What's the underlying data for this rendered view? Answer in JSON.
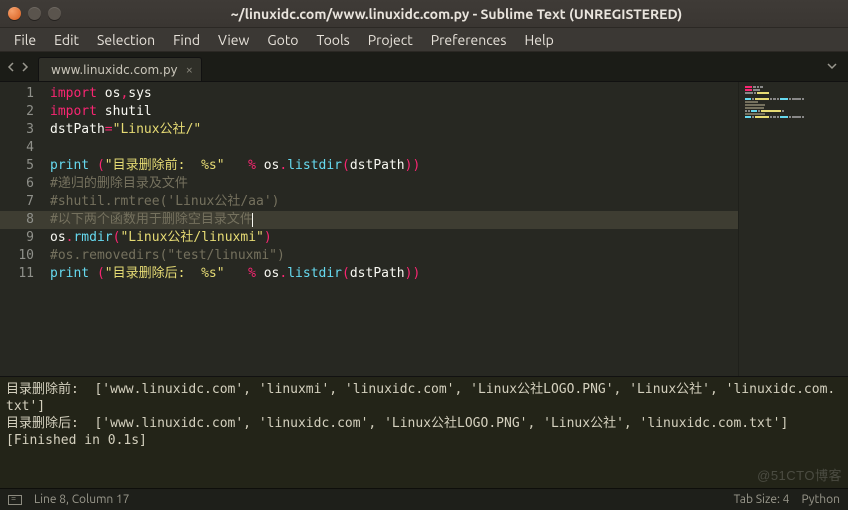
{
  "window": {
    "title": "~/linuxidc.com/www.linuxidc.com.py - Sublime Text (UNREGISTERED)"
  },
  "menu": [
    "File",
    "Edit",
    "Selection",
    "Find",
    "View",
    "Goto",
    "Tools",
    "Project",
    "Preferences",
    "Help"
  ],
  "tab": {
    "label": "www.linuxidc.com.py"
  },
  "code": {
    "highlight_line_index": 7,
    "lines": [
      {
        "n": "1",
        "seg": [
          [
            "kw",
            "import"
          ],
          [
            "sp",
            " "
          ],
          [
            "mod",
            "os"
          ],
          [
            "op",
            ","
          ],
          [
            "mod",
            "sys"
          ]
        ]
      },
      {
        "n": "2",
        "seg": [
          [
            "kw",
            "import"
          ],
          [
            "sp",
            " "
          ],
          [
            "mod",
            "shutil"
          ]
        ]
      },
      {
        "n": "3",
        "seg": [
          [
            "var",
            "dstPath"
          ],
          [
            "op",
            "="
          ],
          [
            "str",
            "\"Linux公社/\""
          ]
        ]
      },
      {
        "n": "4",
        "seg": []
      },
      {
        "n": "5",
        "seg": [
          [
            "fn",
            "print"
          ],
          [
            "sp",
            " "
          ],
          [
            "op",
            "("
          ],
          [
            "str",
            "\"目录删除前:  %s\""
          ],
          [
            "sp",
            "   "
          ],
          [
            "op",
            "%"
          ],
          [
            "sp",
            " "
          ],
          [
            "var",
            "os"
          ],
          [
            "op",
            "."
          ],
          [
            "fn",
            "listdir"
          ],
          [
            "op",
            "("
          ],
          [
            "var",
            "dstPath"
          ],
          [
            "op",
            "))"
          ]
        ]
      },
      {
        "n": "6",
        "seg": [
          [
            "com",
            "#递归的删除目录及文件"
          ]
        ]
      },
      {
        "n": "7",
        "seg": [
          [
            "com",
            "#shutil.rmtree('Linux公社/aa')"
          ]
        ]
      },
      {
        "n": "8",
        "seg": [
          [
            "com",
            "#以下两个函数用于删除空目录文件"
          ]
        ],
        "cursor": true
      },
      {
        "n": "9",
        "seg": [
          [
            "var",
            "os"
          ],
          [
            "op",
            "."
          ],
          [
            "fn",
            "rmdir"
          ],
          [
            "op",
            "("
          ],
          [
            "str",
            "\"Linux公社/linuxmi\""
          ],
          [
            "op",
            ")"
          ]
        ]
      },
      {
        "n": "10",
        "seg": [
          [
            "com",
            "#os.removedirs(\"test/linuxmi\")"
          ]
        ]
      },
      {
        "n": "11",
        "seg": [
          [
            "fn",
            "print"
          ],
          [
            "sp",
            " "
          ],
          [
            "op",
            "("
          ],
          [
            "str",
            "\"目录删除后:  %s\""
          ],
          [
            "sp",
            "   "
          ],
          [
            "op",
            "%"
          ],
          [
            "sp",
            " "
          ],
          [
            "var",
            "os"
          ],
          [
            "op",
            "."
          ],
          [
            "fn",
            "listdir"
          ],
          [
            "op",
            "("
          ],
          [
            "var",
            "dstPath"
          ],
          [
            "op",
            "))"
          ]
        ]
      }
    ]
  },
  "output": {
    "lines": [
      "目录删除前:  ['www.linuxidc.com', 'linuxmi', 'linuxidc.com', 'Linux公社LOGO.PNG', 'Linux公社', 'linuxidc.com.txt']",
      "目录删除后:  ['www.linuxidc.com', 'linuxidc.com', 'Linux公社LOGO.PNG', 'Linux公社', 'linuxidc.com.txt']",
      "[Finished in 0.1s]"
    ]
  },
  "status": {
    "cursor": "Line 8, Column 17",
    "tabsize": "Tab Size: 4",
    "syntax": "Python"
  },
  "watermark": "@51CTO博客"
}
